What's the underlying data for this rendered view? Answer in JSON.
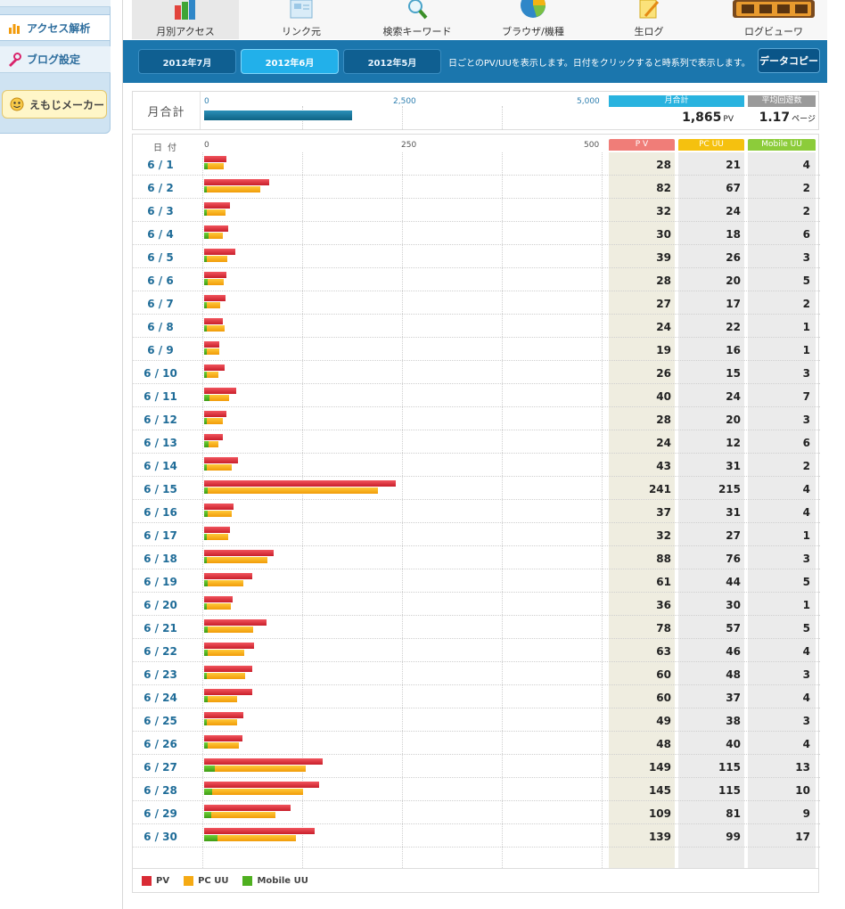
{
  "sidebar": {
    "items": [
      {
        "label": "アクセス解析",
        "icon": "bar-chart-icon"
      },
      {
        "label": "ブログ設定",
        "icon": "wrench-icon"
      },
      {
        "label": "えもじメーカー",
        "icon": "emoji-face-icon"
      }
    ]
  },
  "nav": {
    "items": [
      {
        "label": "月別アクセス",
        "icon": "monthly-books-icon"
      },
      {
        "label": "リンク元",
        "icon": "link-source-icon"
      },
      {
        "label": "検索キーワード",
        "icon": "magnifier-icon"
      },
      {
        "label": "ブラウザ/機種",
        "icon": "pie-chart-icon"
      },
      {
        "label": "生ログ",
        "icon": "notepad-pencil-icon"
      },
      {
        "label": "ログビューワ",
        "icon": "log-viewer-icon"
      }
    ]
  },
  "months": {
    "tabs": [
      "2012年7月",
      "2012年6月",
      "2012年5月"
    ],
    "active": "2012年6月",
    "note": "日ごとのPV/UUを表示します。日付をクリックすると時系列で表示します。",
    "copy_label": "データコピー"
  },
  "summary": {
    "label": "月合計",
    "ticks": [
      "0",
      "2,500",
      "5,000"
    ],
    "axis_max": 5000,
    "total_header": "月合計",
    "total_value": "1,865",
    "total_unit": "PV",
    "avg_header": "平均回遊数",
    "avg_value": "1.17",
    "avg_unit": "ページ"
  },
  "table": {
    "date_header": "日付",
    "ticks": [
      "0",
      "250",
      "500"
    ],
    "axis_max": 500,
    "headers": {
      "pv": "P V",
      "pc": "PC UU",
      "mobile": "Mobile UU"
    }
  },
  "chart_data": {
    "type": "bar",
    "categories": [
      "6 / 1",
      "6 / 2",
      "6 / 3",
      "6 / 4",
      "6 / 5",
      "6 / 6",
      "6 / 7",
      "6 / 8",
      "6 / 9",
      "6 / 10",
      "6 / 11",
      "6 / 12",
      "6 / 13",
      "6 / 14",
      "6 / 15",
      "6 / 16",
      "6 / 17",
      "6 / 18",
      "6 / 19",
      "6 / 20",
      "6 / 21",
      "6 / 22",
      "6 / 23",
      "6 / 24",
      "6 / 25",
      "6 / 26",
      "6 / 27",
      "6 / 28",
      "6 / 29",
      "6 / 30"
    ],
    "series": [
      {
        "name": "PV",
        "values": [
          28,
          82,
          32,
          30,
          39,
          28,
          27,
          24,
          19,
          26,
          40,
          28,
          24,
          43,
          241,
          37,
          32,
          88,
          61,
          36,
          78,
          63,
          60,
          60,
          49,
          48,
          149,
          145,
          109,
          139
        ]
      },
      {
        "name": "PC UU",
        "values": [
          21,
          67,
          24,
          18,
          26,
          20,
          17,
          22,
          16,
          15,
          24,
          20,
          12,
          31,
          215,
          31,
          27,
          76,
          44,
          30,
          57,
          46,
          48,
          37,
          38,
          40,
          115,
          115,
          81,
          99
        ]
      },
      {
        "name": "Mobile UU",
        "values": [
          4,
          2,
          2,
          6,
          3,
          5,
          2,
          1,
          1,
          3,
          7,
          3,
          6,
          2,
          4,
          4,
          1,
          3,
          5,
          1,
          5,
          4,
          3,
          4,
          3,
          4,
          13,
          10,
          9,
          17
        ]
      }
    ],
    "xlim": [
      0,
      500
    ],
    "colors": {
      "pv": "#d92b35",
      "pc": "#f5aa14",
      "mobile": "#4fb020"
    }
  },
  "legend": [
    {
      "label": "PV",
      "color": "#d92b35"
    },
    {
      "label": "PC UU",
      "color": "#f5aa14"
    },
    {
      "label": "Mobile UU",
      "color": "#4fb020"
    }
  ]
}
